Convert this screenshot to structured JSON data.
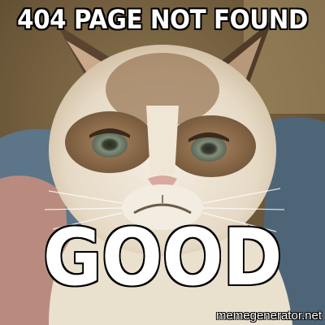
{
  "meme": {
    "top_text": "404 PAGE NOT FOUND",
    "bottom_text": "GOOD",
    "watermark": "memegenerator.net"
  },
  "photo": {
    "subject": "grumpy-cat",
    "colors": {
      "fur_cream": "#efe6d6",
      "fur_brown": "#8a6a48",
      "background": "#6f5a3a",
      "blanket": "#5d7588",
      "eye": "#7a8a78",
      "nose": "#d9a8a0"
    }
  }
}
